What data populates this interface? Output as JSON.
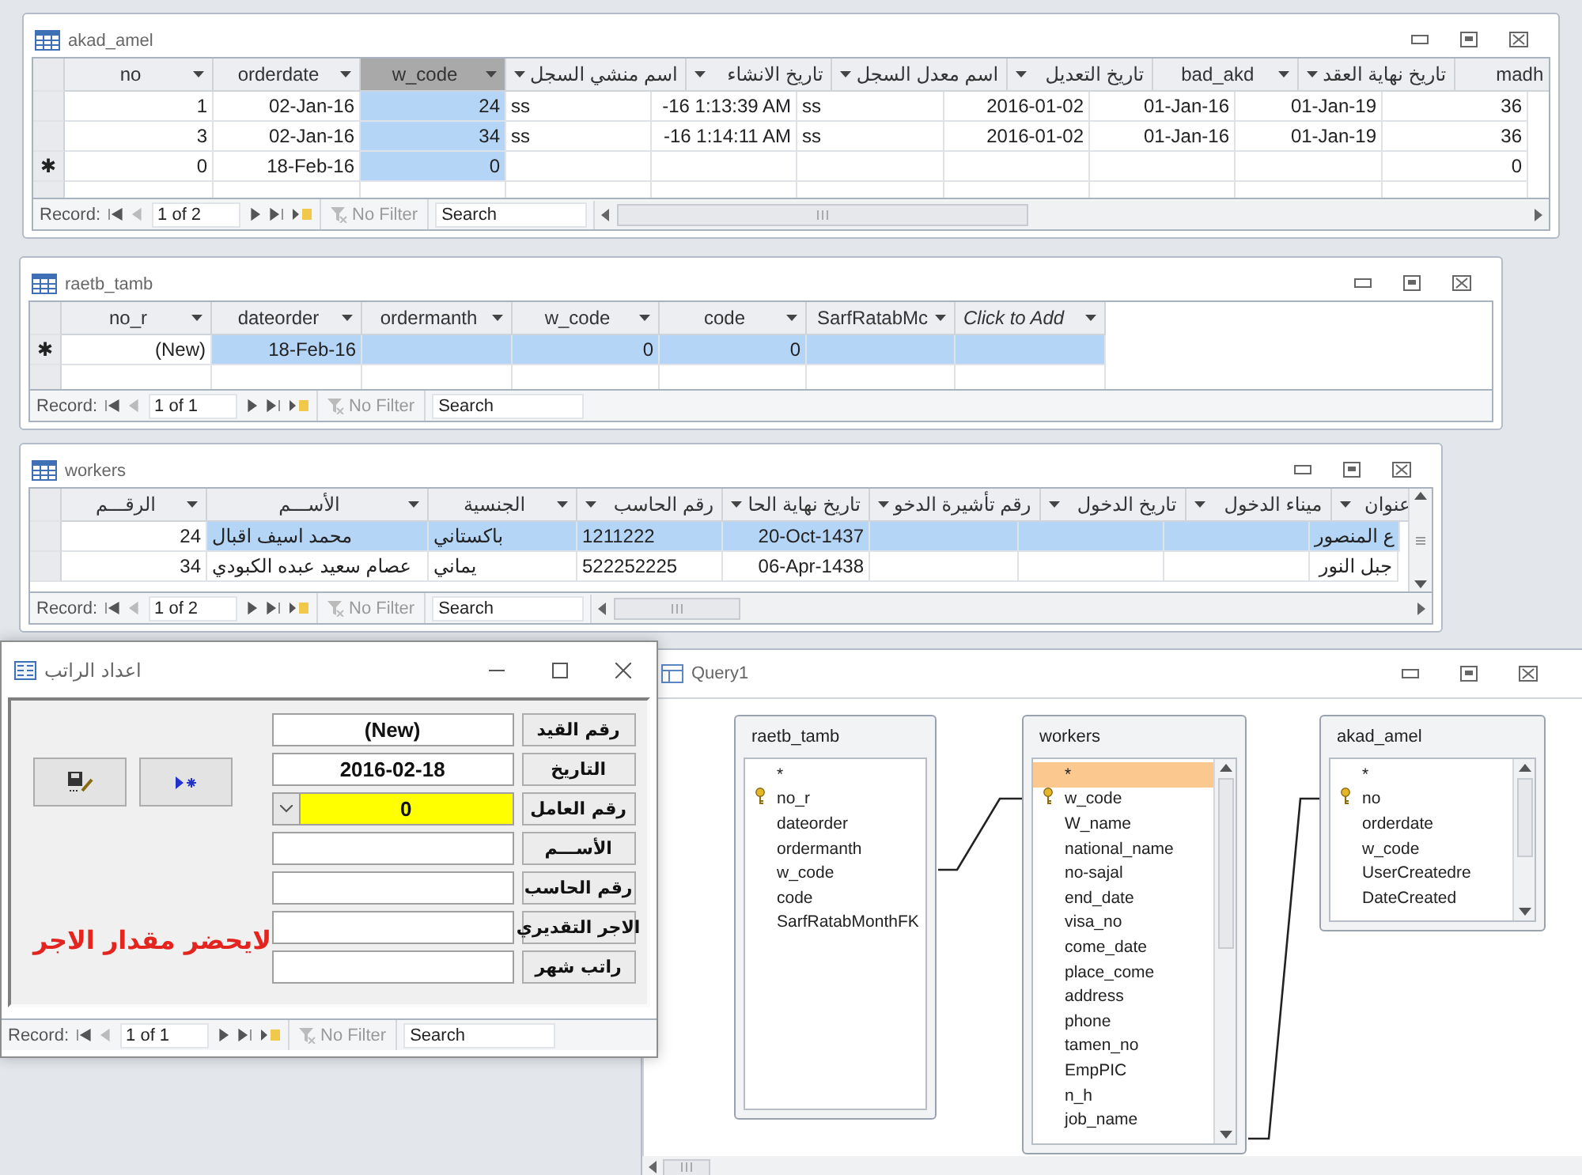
{
  "datasheets": [
    {
      "title": "akad_amel",
      "columns": [
        {
          "label": "no",
          "kind": "ltr",
          "selected": false
        },
        {
          "label": "orderdate",
          "kind": "ltr",
          "selected": false
        },
        {
          "label": "w_code",
          "kind": "ltr",
          "selected": true
        },
        {
          "label": "اسم منشي السجل",
          "kind": "rtl",
          "selected": false
        },
        {
          "label": "تاريخ الانشاء",
          "kind": "rtl",
          "selected": false
        },
        {
          "label": "اسم معدل السجل",
          "kind": "rtl",
          "selected": false
        },
        {
          "label": "تاريخ التعديل",
          "kind": "rtl",
          "selected": false
        },
        {
          "label": "bad_akd",
          "kind": "ltr",
          "selected": false
        },
        {
          "label": "تاريخ نهاية العقد",
          "kind": "rtl",
          "selected": false
        },
        {
          "label": "madh",
          "kind": "ltr",
          "selected": false
        }
      ],
      "rows": [
        {
          "cells": [
            {
              "text": "1",
              "kind": "number",
              "selected": false
            },
            {
              "text": "02-Jan-16",
              "kind": "number",
              "selected": false
            },
            {
              "text": "24",
              "kind": "number",
              "selected": true
            },
            {
              "text": "ss",
              "kind": "text",
              "selected": false
            },
            {
              "text": "-16 1:13:39 AM",
              "kind": "number",
              "selected": false
            },
            {
              "text": "ss",
              "kind": "text",
              "selected": false
            },
            {
              "text": "2016-01-02",
              "kind": "number",
              "selected": false
            },
            {
              "text": "01-Jan-16",
              "kind": "number",
              "selected": false
            },
            {
              "text": "01-Jan-19",
              "kind": "number",
              "selected": false
            },
            {
              "text": "36",
              "kind": "number",
              "selected": false
            }
          ]
        },
        {
          "cells": [
            {
              "text": "3",
              "kind": "number",
              "selected": false
            },
            {
              "text": "02-Jan-16",
              "kind": "number",
              "selected": false
            },
            {
              "text": "34",
              "kind": "number",
              "selected": true
            },
            {
              "text": "ss",
              "kind": "text",
              "selected": false
            },
            {
              "text": "-16 1:14:11 AM",
              "kind": "number",
              "selected": false
            },
            {
              "text": "ss",
              "kind": "text",
              "selected": false
            },
            {
              "text": "2016-01-02",
              "kind": "number",
              "selected": false
            },
            {
              "text": "01-Jan-16",
              "kind": "number",
              "selected": false
            },
            {
              "text": "01-Jan-19",
              "kind": "number",
              "selected": false
            },
            {
              "text": "36",
              "kind": "number",
              "selected": false
            }
          ]
        },
        {
          "marker": "✱",
          "cells": [
            {
              "text": "0",
              "kind": "number",
              "selected": false
            },
            {
              "text": "18-Feb-16",
              "kind": "number",
              "selected": false
            },
            {
              "text": "0",
              "kind": "number",
              "selected": true
            },
            {
              "kind": "empty",
              "selected": false
            },
            {
              "kind": "empty",
              "selected": false
            },
            {
              "kind": "empty",
              "selected": false
            },
            {
              "kind": "empty",
              "selected": false
            },
            {
              "kind": "empty",
              "selected": false
            },
            {
              "kind": "empty",
              "selected": false
            },
            {
              "text": "0",
              "kind": "number",
              "selected": false
            }
          ]
        }
      ],
      "navigator": {
        "label": "Record:",
        "position": "1 of 2",
        "filter": "No Filter",
        "search": "Search"
      }
    },
    {
      "title": "raetb_tamb",
      "columns": [
        {
          "label": "no_r",
          "kind": "ltr",
          "selected": false
        },
        {
          "label": "dateorder",
          "kind": "ltr",
          "selected": false
        },
        {
          "label": "ordermanth",
          "kind": "ltr",
          "selected": false
        },
        {
          "label": "w_code",
          "kind": "ltr",
          "selected": false
        },
        {
          "label": "code",
          "kind": "ltr",
          "selected": false
        },
        {
          "label": "SarfRatabMc",
          "kind": "ltr",
          "selected": false
        },
        {
          "label": "Click to Add",
          "kind": "add",
          "selected": false
        }
      ],
      "rows": [
        {
          "marker": "✱",
          "cells": [
            {
              "text": "(New)",
              "kind": "number",
              "selected": false
            },
            {
              "text": "18-Feb-16",
              "kind": "number",
              "selected": true
            },
            {
              "kind": "empty",
              "selected": true
            },
            {
              "text": "0",
              "kind": "number",
              "selected": true
            },
            {
              "text": "0",
              "kind": "number",
              "selected": true
            },
            {
              "kind": "empty",
              "selected": true
            },
            {
              "kind": "empty",
              "selected": true
            }
          ]
        }
      ],
      "navigator": {
        "label": "Record:",
        "position": "1 of 1",
        "filter": "No Filter",
        "search": "Search"
      }
    },
    {
      "title": "workers",
      "columns": [
        {
          "label": "الرقـــم",
          "kind": "ltr",
          "selected": false
        },
        {
          "label": "الأســـم",
          "kind": "ltr",
          "selected": false
        },
        {
          "label": "الجنسية",
          "kind": "ltr",
          "selected": false
        },
        {
          "label": "رقم الحاسب",
          "kind": "rtl",
          "selected": false
        },
        {
          "label": "تاريخ نهاية الحا",
          "kind": "rtl",
          "selected": false
        },
        {
          "label": "رقم تأشيرة الدخو",
          "kind": "rtl",
          "selected": false
        },
        {
          "label": "تاريخ الدخول",
          "kind": "rtl",
          "selected": false
        },
        {
          "label": "ميناء الدخول",
          "kind": "rtl",
          "selected": false
        },
        {
          "label": "عنوان",
          "kind": "rtl",
          "selected": false
        }
      ],
      "rows": [
        {
          "cells": [
            {
              "text": "24",
              "kind": "number",
              "selected": false
            },
            {
              "text": "محمد اسيف اقبال",
              "kind": "text",
              "selected": true
            },
            {
              "text": "باكستاني",
              "kind": "text",
              "selected": true
            },
            {
              "text": "1211222",
              "kind": "text",
              "selected": true
            },
            {
              "text": "20-Oct-1437",
              "kind": "number",
              "selected": true
            },
            {
              "kind": "empty",
              "selected": true
            },
            {
              "kind": "empty",
              "selected": true
            },
            {
              "kind": "empty",
              "selected": true
            },
            {
              "text": "ع المنصور",
              "kind": "number",
              "selected": true
            }
          ]
        },
        {
          "cells": [
            {
              "text": "34",
              "kind": "number",
              "selected": false
            },
            {
              "text": "عصام سعيد عبده الكبودي",
              "kind": "text",
              "selected": false
            },
            {
              "text": "يماني",
              "kind": "text",
              "selected": false
            },
            {
              "text": "522252225",
              "kind": "text",
              "selected": false
            },
            {
              "text": "06-Apr-1438",
              "kind": "number",
              "selected": false
            },
            {
              "kind": "empty",
              "selected": false
            },
            {
              "kind": "empty",
              "selected": false
            },
            {
              "kind": "empty",
              "selected": false
            },
            {
              "text": "جبل النور",
              "kind": "number",
              "selected": false
            }
          ]
        }
      ],
      "navigator": {
        "label": "Record:",
        "position": "1 of 2",
        "filter": "No Filter",
        "search": "Search"
      }
    }
  ],
  "query": {
    "title": "Query1",
    "tables": [
      {
        "title": "raetb_tamb",
        "fields": [
          {
            "name": "*",
            "key": false,
            "selected": false
          },
          {
            "name": "no_r",
            "key": true,
            "selected": false
          },
          {
            "name": "dateorder",
            "key": false,
            "selected": false
          },
          {
            "name": "ordermanth",
            "key": false,
            "selected": false
          },
          {
            "name": "w_code",
            "key": false,
            "selected": false
          },
          {
            "name": "code",
            "key": false,
            "selected": false
          },
          {
            "name": "SarfRatabMonthFK",
            "key": false,
            "selected": false
          }
        ]
      },
      {
        "title": "workers",
        "fields": [
          {
            "name": "*",
            "key": false,
            "selected": true
          },
          {
            "name": "w_code",
            "key": true,
            "selected": false
          },
          {
            "name": "W_name",
            "key": false,
            "selected": false
          },
          {
            "name": "national_name",
            "key": false,
            "selected": false
          },
          {
            "name": "no-sajal",
            "key": false,
            "selected": false
          },
          {
            "name": "end_date",
            "key": false,
            "selected": false
          },
          {
            "name": "visa_no",
            "key": false,
            "selected": false
          },
          {
            "name": "come_date",
            "key": false,
            "selected": false
          },
          {
            "name": "place_come",
            "key": false,
            "selected": false
          },
          {
            "name": "address",
            "key": false,
            "selected": false
          },
          {
            "name": "phone",
            "key": false,
            "selected": false
          },
          {
            "name": "tamen_no",
            "key": false,
            "selected": false
          },
          {
            "name": "EmpPIC",
            "key": false,
            "selected": false
          },
          {
            "name": "n_h",
            "key": false,
            "selected": false
          },
          {
            "name": "job_name",
            "key": false,
            "selected": false
          }
        ]
      },
      {
        "title": "akad_amel",
        "fields": [
          {
            "name": "*",
            "key": false,
            "selected": false
          },
          {
            "name": "no",
            "key": true,
            "selected": false
          },
          {
            "name": "orderdate",
            "key": false,
            "selected": false
          },
          {
            "name": "w_code",
            "key": false,
            "selected": false
          },
          {
            "name": "UserCreatedre",
            "key": false,
            "selected": false
          },
          {
            "name": "DateCreated",
            "key": false,
            "selected": false
          }
        ]
      }
    ]
  },
  "form": {
    "title": "اعداد الراتب",
    "fields": [
      {
        "label": "رقم القيد",
        "value": "(New)",
        "kind": "text",
        "focused": false
      },
      {
        "label": "التاريخ",
        "value": "2016-02-18",
        "kind": "text",
        "focused": false
      },
      {
        "label": "رقم العامل",
        "value": "0",
        "kind": "combo",
        "focused": true
      },
      {
        "label": "الأســـم",
        "kind": "text",
        "focused": false
      },
      {
        "label": "رقم الحاسب",
        "kind": "text",
        "focused": false
      },
      {
        "label": "الاجر التقديري",
        "kind": "text",
        "focused": false
      },
      {
        "label": "راتب شهر",
        "kind": "text",
        "focused": false
      }
    ],
    "message": "لايحضر مقدار الاجر",
    "navigator": {
      "label": "Record:",
      "position": "1 of 1",
      "filter": "No Filter",
      "search": "Search"
    }
  }
}
